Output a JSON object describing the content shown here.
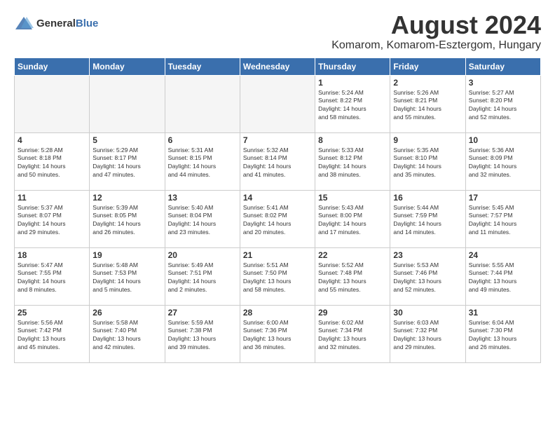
{
  "header": {
    "logo_general": "General",
    "logo_blue": "Blue",
    "month_year": "August 2024",
    "location": "Komarom, Komarom-Esztergom, Hungary"
  },
  "weekdays": [
    "Sunday",
    "Monday",
    "Tuesday",
    "Wednesday",
    "Thursday",
    "Friday",
    "Saturday"
  ],
  "weeks": [
    [
      {
        "day": "",
        "info": "",
        "empty": true
      },
      {
        "day": "",
        "info": "",
        "empty": true
      },
      {
        "day": "",
        "info": "",
        "empty": true
      },
      {
        "day": "",
        "info": "",
        "empty": true
      },
      {
        "day": "1",
        "info": "Sunrise: 5:24 AM\nSunset: 8:22 PM\nDaylight: 14 hours\nand 58 minutes."
      },
      {
        "day": "2",
        "info": "Sunrise: 5:26 AM\nSunset: 8:21 PM\nDaylight: 14 hours\nand 55 minutes."
      },
      {
        "day": "3",
        "info": "Sunrise: 5:27 AM\nSunset: 8:20 PM\nDaylight: 14 hours\nand 52 minutes."
      }
    ],
    [
      {
        "day": "4",
        "info": "Sunrise: 5:28 AM\nSunset: 8:18 PM\nDaylight: 14 hours\nand 50 minutes."
      },
      {
        "day": "5",
        "info": "Sunrise: 5:29 AM\nSunset: 8:17 PM\nDaylight: 14 hours\nand 47 minutes."
      },
      {
        "day": "6",
        "info": "Sunrise: 5:31 AM\nSunset: 8:15 PM\nDaylight: 14 hours\nand 44 minutes."
      },
      {
        "day": "7",
        "info": "Sunrise: 5:32 AM\nSunset: 8:14 PM\nDaylight: 14 hours\nand 41 minutes."
      },
      {
        "day": "8",
        "info": "Sunrise: 5:33 AM\nSunset: 8:12 PM\nDaylight: 14 hours\nand 38 minutes."
      },
      {
        "day": "9",
        "info": "Sunrise: 5:35 AM\nSunset: 8:10 PM\nDaylight: 14 hours\nand 35 minutes."
      },
      {
        "day": "10",
        "info": "Sunrise: 5:36 AM\nSunset: 8:09 PM\nDaylight: 14 hours\nand 32 minutes."
      }
    ],
    [
      {
        "day": "11",
        "info": "Sunrise: 5:37 AM\nSunset: 8:07 PM\nDaylight: 14 hours\nand 29 minutes."
      },
      {
        "day": "12",
        "info": "Sunrise: 5:39 AM\nSunset: 8:05 PM\nDaylight: 14 hours\nand 26 minutes."
      },
      {
        "day": "13",
        "info": "Sunrise: 5:40 AM\nSunset: 8:04 PM\nDaylight: 14 hours\nand 23 minutes."
      },
      {
        "day": "14",
        "info": "Sunrise: 5:41 AM\nSunset: 8:02 PM\nDaylight: 14 hours\nand 20 minutes."
      },
      {
        "day": "15",
        "info": "Sunrise: 5:43 AM\nSunset: 8:00 PM\nDaylight: 14 hours\nand 17 minutes."
      },
      {
        "day": "16",
        "info": "Sunrise: 5:44 AM\nSunset: 7:59 PM\nDaylight: 14 hours\nand 14 minutes."
      },
      {
        "day": "17",
        "info": "Sunrise: 5:45 AM\nSunset: 7:57 PM\nDaylight: 14 hours\nand 11 minutes."
      }
    ],
    [
      {
        "day": "18",
        "info": "Sunrise: 5:47 AM\nSunset: 7:55 PM\nDaylight: 14 hours\nand 8 minutes."
      },
      {
        "day": "19",
        "info": "Sunrise: 5:48 AM\nSunset: 7:53 PM\nDaylight: 14 hours\nand 5 minutes."
      },
      {
        "day": "20",
        "info": "Sunrise: 5:49 AM\nSunset: 7:51 PM\nDaylight: 14 hours\nand 2 minutes."
      },
      {
        "day": "21",
        "info": "Sunrise: 5:51 AM\nSunset: 7:50 PM\nDaylight: 13 hours\nand 58 minutes."
      },
      {
        "day": "22",
        "info": "Sunrise: 5:52 AM\nSunset: 7:48 PM\nDaylight: 13 hours\nand 55 minutes."
      },
      {
        "day": "23",
        "info": "Sunrise: 5:53 AM\nSunset: 7:46 PM\nDaylight: 13 hours\nand 52 minutes."
      },
      {
        "day": "24",
        "info": "Sunrise: 5:55 AM\nSunset: 7:44 PM\nDaylight: 13 hours\nand 49 minutes."
      }
    ],
    [
      {
        "day": "25",
        "info": "Sunrise: 5:56 AM\nSunset: 7:42 PM\nDaylight: 13 hours\nand 45 minutes."
      },
      {
        "day": "26",
        "info": "Sunrise: 5:58 AM\nSunset: 7:40 PM\nDaylight: 13 hours\nand 42 minutes."
      },
      {
        "day": "27",
        "info": "Sunrise: 5:59 AM\nSunset: 7:38 PM\nDaylight: 13 hours\nand 39 minutes."
      },
      {
        "day": "28",
        "info": "Sunrise: 6:00 AM\nSunset: 7:36 PM\nDaylight: 13 hours\nand 36 minutes."
      },
      {
        "day": "29",
        "info": "Sunrise: 6:02 AM\nSunset: 7:34 PM\nDaylight: 13 hours\nand 32 minutes."
      },
      {
        "day": "30",
        "info": "Sunrise: 6:03 AM\nSunset: 7:32 PM\nDaylight: 13 hours\nand 29 minutes."
      },
      {
        "day": "31",
        "info": "Sunrise: 6:04 AM\nSunset: 7:30 PM\nDaylight: 13 hours\nand 26 minutes."
      }
    ]
  ]
}
